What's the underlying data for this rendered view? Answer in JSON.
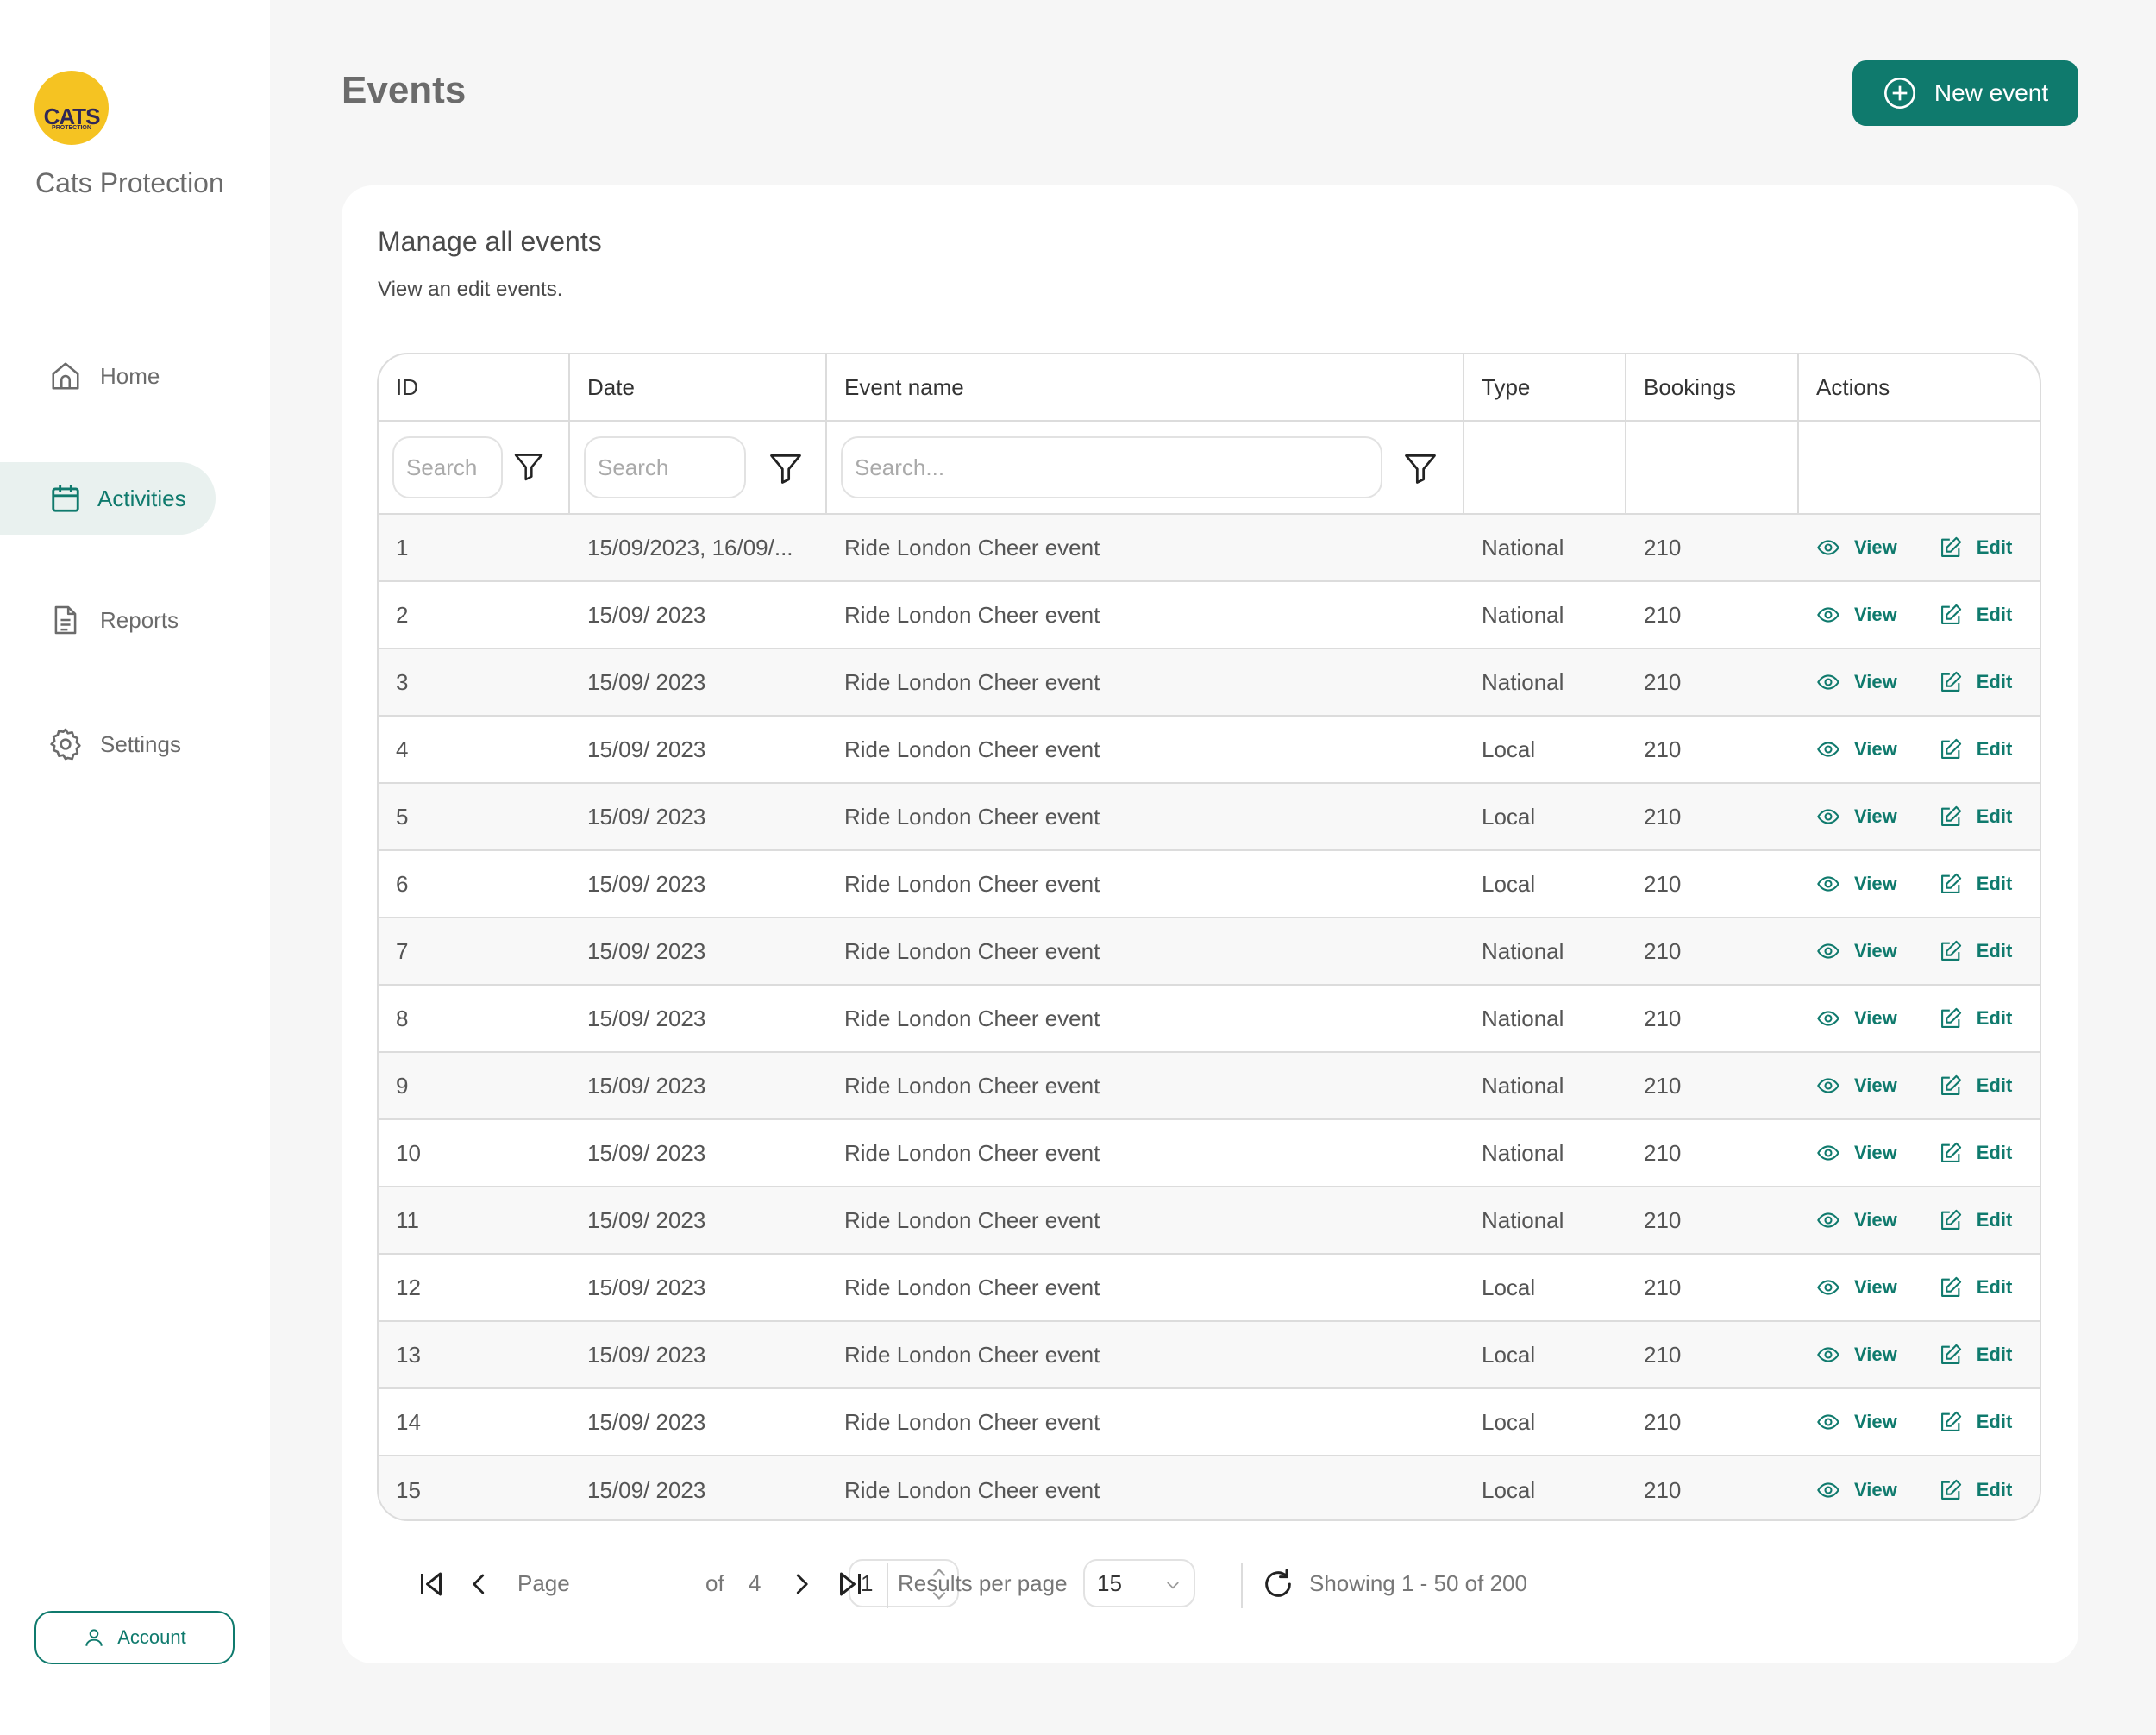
{
  "brand": {
    "logo_text": "CATS",
    "logo_sub": "PROTECTION",
    "name": "Cats Protection"
  },
  "nav": {
    "home": "Home",
    "activities": "Activities",
    "reports": "Reports",
    "settings": "Settings",
    "account": "Account"
  },
  "header": {
    "title": "Events",
    "new_event": "New event"
  },
  "card": {
    "title": "Manage all events",
    "subtitle": "View an edit events."
  },
  "table": {
    "columns": [
      "ID",
      "Date",
      "Event name",
      "Type",
      "Bookings",
      "Actions"
    ],
    "filters": {
      "id_placeholder": "Search",
      "date_placeholder": "Search",
      "name_placeholder": "Search..."
    },
    "action_view": "View",
    "action_edit": "Edit",
    "rows": [
      {
        "id": "1",
        "date": "15/09/2023, 16/09/...",
        "name": "Ride London Cheer event",
        "type": "National",
        "bookings": "210"
      },
      {
        "id": "2",
        "date": "15/09/ 2023",
        "name": "Ride London Cheer event",
        "type": "National",
        "bookings": "210"
      },
      {
        "id": "3",
        "date": "15/09/ 2023",
        "name": "Ride London Cheer event",
        "type": "National",
        "bookings": "210"
      },
      {
        "id": "4",
        "date": "15/09/ 2023",
        "name": "Ride London Cheer event",
        "type": "Local",
        "bookings": "210"
      },
      {
        "id": "5",
        "date": "15/09/ 2023",
        "name": "Ride London Cheer event",
        "type": "Local",
        "bookings": "210"
      },
      {
        "id": "6",
        "date": "15/09/ 2023",
        "name": "Ride London Cheer event",
        "type": "Local",
        "bookings": "210"
      },
      {
        "id": "7",
        "date": "15/09/ 2023",
        "name": "Ride London Cheer event",
        "type": "National",
        "bookings": "210"
      },
      {
        "id": "8",
        "date": "15/09/ 2023",
        "name": "Ride London Cheer event",
        "type": "National",
        "bookings": "210"
      },
      {
        "id": "9",
        "date": "15/09/ 2023",
        "name": "Ride London Cheer event",
        "type": "National",
        "bookings": "210"
      },
      {
        "id": "10",
        "date": "15/09/ 2023",
        "name": "Ride London Cheer event",
        "type": "National",
        "bookings": "210"
      },
      {
        "id": "11",
        "date": "15/09/ 2023",
        "name": "Ride London Cheer event",
        "type": "National",
        "bookings": "210"
      },
      {
        "id": "12",
        "date": "15/09/ 2023",
        "name": "Ride London Cheer event",
        "type": "Local",
        "bookings": "210"
      },
      {
        "id": "13",
        "date": "15/09/ 2023",
        "name": "Ride London Cheer event",
        "type": "Local",
        "bookings": "210"
      },
      {
        "id": "14",
        "date": "15/09/ 2023",
        "name": "Ride London Cheer event",
        "type": "Local",
        "bookings": "210"
      },
      {
        "id": "15",
        "date": "15/09/ 2023",
        "name": "Ride London Cheer event",
        "type": "Local",
        "bookings": "210"
      }
    ]
  },
  "pagination": {
    "page_label": "Page",
    "page_value": "1",
    "of_label": "of",
    "total_pages": "4",
    "results_label": "Results per page",
    "results_value": "15",
    "showing": "Showing 1 - 50 of 200"
  },
  "colors": {
    "accent": "#0f7a6d",
    "logo": "#f5c322",
    "active_bg": "#e9f1ef"
  }
}
